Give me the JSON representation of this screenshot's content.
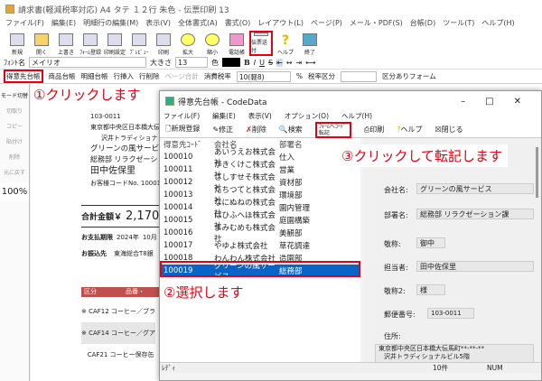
{
  "window": {
    "title": "請求書(軽減税率対応) A4 タテ １２行 朱色 - 伝票印刷 13"
  },
  "menu": [
    "ファイル(F)",
    "編集(E)",
    "明細行の編集(M)",
    "表示(V)",
    "全体書式(A)",
    "書式(O)",
    "レイアウト(L)",
    "ページ(P)",
    "メール・PDF(S)",
    "台帳(D)",
    "ツール(T)",
    "ヘルプ(H)"
  ],
  "toolbar": [
    "新規",
    "開く",
    "上書き",
    "ﾌｫｰﾑ登録",
    "印刷設定",
    "ﾌﾟﾚﾋﾞｭｰ",
    "印刷",
    "拡大",
    "縮小",
    "電話帳",
    "伝票送付",
    "ヘルプ",
    "終了"
  ],
  "fontbar": {
    "font_label": "ﾌｫﾝﾄ名",
    "font_value": "メイリオ",
    "size_label": "大きさ",
    "size_value": "13",
    "color_label": "色",
    "bold": "B",
    "italic": "I",
    "underline": "U",
    "strike": "S"
  },
  "row3": {
    "customer_ledger": "得意先台帳",
    "product_ledger": "商品台帳",
    "detail_ledger": "明細台帳",
    "insert_row": "行挿入",
    "delete_row": "行削除",
    "page_total": "ページ合計",
    "tax_rate_label": "消費税率",
    "tax_rate_value": "10(軽8)",
    "percent": "%",
    "tax_class_label": "税率区分",
    "form_label": "区分ありフォーム"
  },
  "leftpanel": {
    "mode": "モード切替",
    "cut": "切取り",
    "copy": "コピー",
    "paste": "貼付け",
    "delete": "削除",
    "undo": "元に戻す",
    "zoom": "100%"
  },
  "doc": {
    "postal": "103-0011",
    "address1": "東京都中央区日本橋大伝馬町",
    "address2": "沢井トラディショナ",
    "company": "グリーンの風サービス",
    "dept": "総務部 リラクゼーシ",
    "person": "田中佐保里",
    "code_label": "お客様コードNo.",
    "code_value": "10001",
    "total_label": "合計金額￥",
    "total_value": "2,170",
    "due_label": "お支払期限",
    "due_year": "2024年",
    "due_month": "10月",
    "bank_label": "お振込先",
    "bank_value": "東海総合T8銀",
    "col_kubun": "区分",
    "col_item": "品番・",
    "items": [
      {
        "mark": "※",
        "text": "CAF12 コーヒー／ブラ"
      },
      {
        "mark": "※",
        "text": "CAF14 コーヒー／グア"
      },
      {
        "mark": "",
        "text": "CAF21 コーヒー保存缶"
      }
    ]
  },
  "annotations": {
    "step1": "①クリックします",
    "step2": "②選択します",
    "step3": "③クリックして転記します"
  },
  "dialog": {
    "title": "得意先台帳 - CodeData",
    "menu": [
      "ファイル(F)",
      "編集(E)",
      "表示(V)",
      "オプション(O)",
      "ヘルプ(H)"
    ],
    "toolbar": {
      "new": "新規登録",
      "edit": "修正",
      "delete": "削除",
      "search": "検索",
      "transfer": "ﾌｫｰﾑへｺｰﾄﾞ転記",
      "print": "印刷",
      "help": "ヘルプ",
      "close": "閉じる"
    },
    "columns": [
      "得意先ｺｰﾄﾞ",
      "会社名",
      "部署名"
    ],
    "rows": [
      [
        "100010",
        "あいうえお株式会社",
        "仕入"
      ],
      [
        "100011",
        "かきくけこ株式会社",
        "営業"
      ],
      [
        "100012",
        "さしすせそ株式会社",
        "資材部"
      ],
      [
        "100013",
        "たちつてと株式会社",
        "環境部"
      ],
      [
        "100014",
        "なにぬねの株式会社",
        "園内管理"
      ],
      [
        "100015",
        "はひふへほ株式会社",
        "庭園構築"
      ],
      [
        "100016",
        "まみむめも株式会社",
        "美観部"
      ],
      [
        "100017",
        "やゆよ株式会社",
        "草花調達"
      ],
      [
        "100018",
        "わんわん株式会社",
        "造園部"
      ],
      [
        "100019",
        "グリーンの風サービス",
        "総務部"
      ]
    ],
    "selected_index": 9,
    "detail": {
      "company_label": "会社名:",
      "company": "グリーンの風サービス",
      "dept_label": "部署名:",
      "dept": "総務部 リラクゼーション課",
      "honorific_label": "敬称:",
      "honorific": "御中",
      "person_label": "担当者:",
      "person": "田中佐保里",
      "honorific2_label": "敬称2:",
      "honorific2": "様",
      "postal_label": "郵便番号:",
      "postal": "103-0011",
      "address_label": "住所:",
      "address1": "東京都中央区日本橋大伝馬町**-**-**",
      "address2": "沢井トラディショナルビル5階"
    },
    "status": {
      "ready": "ﾚﾃﾞｨ",
      "count": "10件",
      "num": "NUM"
    }
  },
  "colors": {
    "annotation": "#e60012",
    "selection": "#0a64c8",
    "table_header": "#c0504d"
  }
}
